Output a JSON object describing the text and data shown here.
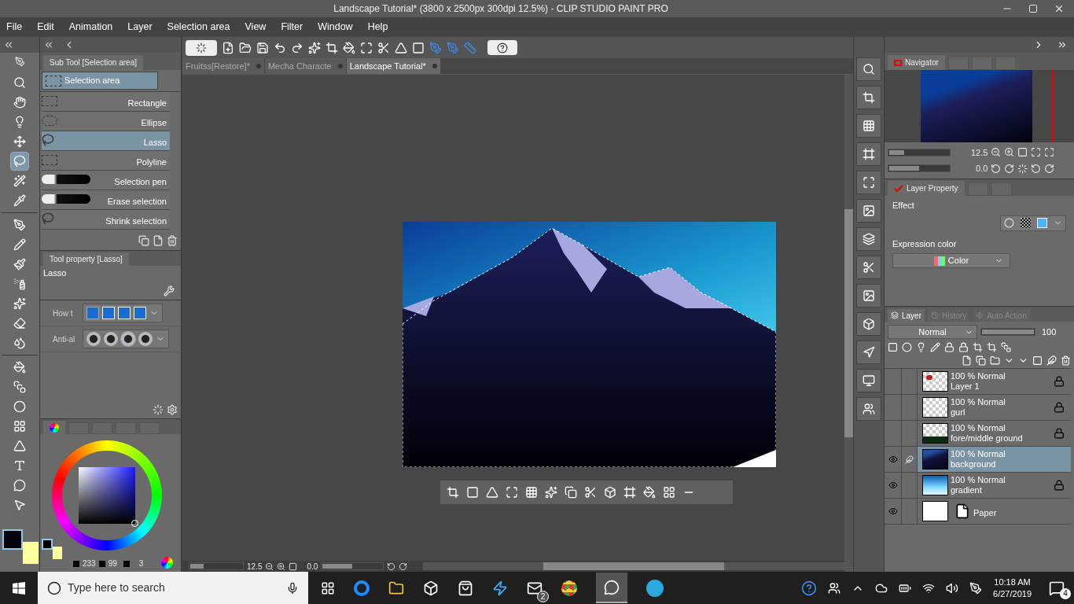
{
  "window": {
    "title": "Landscape Tutorial* (3800 x 2500px 300dpi 12.5%) - CLIP STUDIO PAINT PRO"
  },
  "menu": [
    "File",
    "Edit",
    "Animation",
    "Layer",
    "Selection area",
    "View",
    "Filter",
    "Window",
    "Help"
  ],
  "tools": [
    {
      "selected": false
    },
    {
      "selected": false
    },
    {
      "selected": false
    },
    {
      "selected": false
    },
    {
      "selected": true
    },
    {
      "selected": false
    },
    {
      "selected": false
    },
    {
      "selected": false
    },
    {
      "selected": false
    },
    {
      "selected": false
    },
    {
      "selected": false
    },
    {
      "selected": false
    },
    {
      "selected": false
    },
    {
      "selected": false
    },
    {
      "selected": false
    },
    {
      "selected": false
    },
    {
      "selected": false
    },
    {
      "selected": false
    },
    {
      "selected": false
    },
    {
      "selected": false
    },
    {
      "selected": false
    },
    {
      "selected": false
    }
  ],
  "document_tabs": [
    {
      "label": "Fruitss[Restore]*",
      "selected": false
    },
    {
      "label": "Mecha Characte",
      "selected": false
    },
    {
      "label": "Landscape Tutorial*",
      "selected": true
    }
  ],
  "sub_tool": {
    "title": "Sub Tool [Selection area]",
    "group": "Selection area",
    "items": [
      {
        "label": "Rectangle",
        "selected": false
      },
      {
        "label": "Ellipse",
        "selected": false
      },
      {
        "label": "Lasso",
        "selected": true
      },
      {
        "label": "Polyline",
        "selected": false
      },
      {
        "label": "Selection pen",
        "selected": false
      },
      {
        "label": "Erase selection",
        "selected": false
      },
      {
        "label": "Shrink selection",
        "selected": false
      }
    ]
  },
  "tool_property": {
    "title": "Tool property [Lasso]",
    "name": "Lasso",
    "rows": [
      {
        "label": "How t"
      },
      {
        "label": "Anti-al"
      }
    ]
  },
  "color": {
    "h": "233",
    "s": "99",
    "v": "3"
  },
  "navigator": {
    "title": "Navigator",
    "zoom": "12.5",
    "zoom_slider": {
      "level": 0.25
    },
    "rotation": "0.0",
    "rotation_slider": {
      "level": 0.5
    }
  },
  "layer_property": {
    "title": "Layer Property",
    "effect_label": "Effect",
    "expression_label": "Expression color",
    "expression_value": "Color"
  },
  "layer_panel": {
    "tabs": [
      {
        "label": "Layer",
        "selected": true
      },
      {
        "label": "History",
        "selected": false
      },
      {
        "label": "Auto Action",
        "selected": false
      }
    ],
    "blend_mode": "Normal",
    "opacity": "100",
    "opacity_slider": {
      "level": 1
    },
    "layers": [
      {
        "kind": "raster",
        "mode": "100 % Normal",
        "name": "Layer 1",
        "visible": false,
        "locked": true,
        "selected": false
      },
      {
        "kind": "raster",
        "mode": "100 % Normal",
        "name": "gurl",
        "visible": false,
        "locked": true,
        "selected": false
      },
      {
        "kind": "raster",
        "mode": "100 % Normal",
        "name": "fore/middle ground",
        "visible": false,
        "locked": true,
        "selected": false
      },
      {
        "kind": "raster",
        "mode": "100 % Normal",
        "name": "background",
        "visible": true,
        "locked": false,
        "selected": true
      },
      {
        "kind": "raster",
        "mode": "100 % Normal",
        "name": "gradient",
        "visible": true,
        "locked": true,
        "selected": false
      },
      {
        "kind": "paper",
        "name": "Paper",
        "visible": true,
        "locked": false,
        "selected": false
      }
    ]
  },
  "canvas_status": {
    "zoom": "12.5",
    "zoom_slider": {
      "level": 0.25
    },
    "rotation": "0.0",
    "rotation_slider": {
      "level": 0.5
    }
  },
  "taskbar": {
    "search_placeholder": "Type here to search",
    "mail_badge": "2",
    "time": "10:18 AM",
    "date": "6/27/2019",
    "notification_badge": "4"
  }
}
